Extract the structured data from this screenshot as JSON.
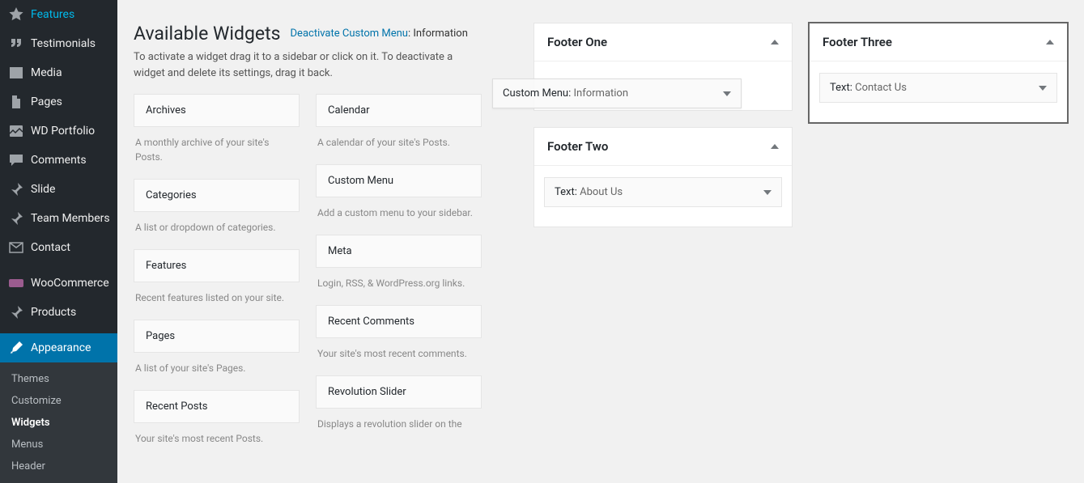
{
  "sidebar": {
    "items": [
      {
        "label": "Features",
        "icon": "star"
      },
      {
        "label": "Testimonials",
        "icon": "quote"
      },
      {
        "label": "Media",
        "icon": "media"
      },
      {
        "label": "Pages",
        "icon": "page"
      },
      {
        "label": "WD Portfolio",
        "icon": "portfolio"
      },
      {
        "label": "Comments",
        "icon": "comment"
      },
      {
        "label": "Slide",
        "icon": "pin"
      },
      {
        "label": "Team Members",
        "icon": "pin"
      },
      {
        "label": "Contact",
        "icon": "mail"
      },
      {
        "label": "WooCommerce",
        "icon": "woo"
      },
      {
        "label": "Products",
        "icon": "pin"
      },
      {
        "label": "Appearance",
        "icon": "brush"
      }
    ],
    "submenu": [
      "Themes",
      "Customize",
      "Widgets",
      "Menus",
      "Header"
    ],
    "submenu_current": "Widgets"
  },
  "available": {
    "title": "Available Widgets",
    "deactivate_link": "Deactivate Custom Menu",
    "deactivate_suffix": ": Information",
    "description": "To activate a widget drag it to a sidebar or click on it. To deactivate a widget and delete its settings, drag it back.",
    "col1": [
      {
        "name": "Archives",
        "desc": "A monthly archive of your site's Posts."
      },
      {
        "name": "Categories",
        "desc": "A list or dropdown of categories."
      },
      {
        "name": "Features",
        "desc": "Recent features listed on your site."
      },
      {
        "name": "Pages",
        "desc": "A list of your site's Pages."
      },
      {
        "name": "Recent Posts",
        "desc": "Your site's most recent Posts."
      }
    ],
    "col2": [
      {
        "name": "Calendar",
        "desc": "A calendar of your site's Posts."
      },
      {
        "name": "Custom Menu",
        "desc": "Add a custom menu to your sidebar."
      },
      {
        "name": "Meta",
        "desc": "Login, RSS, & WordPress.org links."
      },
      {
        "name": "Recent Comments",
        "desc": "Your site's most recent comments."
      },
      {
        "name": "Revolution Slider",
        "desc": "Displays a revolution slider on the"
      }
    ]
  },
  "areas": {
    "left_col": [
      {
        "title": "Footer One",
        "widgets": []
      },
      {
        "title": "Footer Two",
        "widgets": [
          {
            "prefix": "Text:",
            "label": "About Us"
          }
        ]
      }
    ],
    "right_col": [
      {
        "title": "Footer Three",
        "widgets": [
          {
            "prefix": "Text:",
            "label": "Contact Us"
          }
        ],
        "outlined": true
      }
    ]
  },
  "drag_ghost": {
    "prefix": "Custom Menu:",
    "label": "Information"
  }
}
